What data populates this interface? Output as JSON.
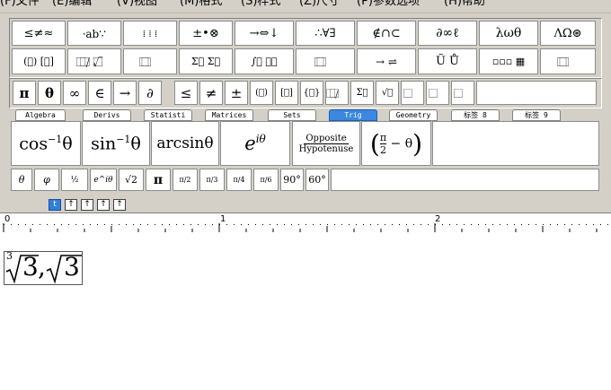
{
  "menubar": {
    "items": [
      {
        "label": "(F)文件"
      },
      {
        "label": "(E)编辑"
      },
      {
        "label": "(V)视图"
      },
      {
        "label": "(M)格式"
      },
      {
        "label": "(S)样式"
      },
      {
        "label": "(Z)尺寸"
      },
      {
        "label": "(P)参数选项"
      },
      {
        "label": "(H)帮助"
      }
    ]
  },
  "symbol_palettes": [
    [
      "≤≠≈",
      "⸱ab∵",
      "⁞ ⁞ ⁞",
      "±•⊗",
      "→⇔↓",
      "∴∀∃",
      "∉∩⊂",
      "∂∞ℓ",
      "λωθ",
      "ΛΩ⊛"
    ],
    [
      "(⃞) [⃞]",
      "⃞/⃞ √⃞",
      "⃞ ⃞",
      "Σ⃞ Σ⃞",
      "∫⃞ ∮⃞",
      "⃞ ⃞",
      "→ ⇌",
      "Ũ Ů",
      "▫▫▫ ▦",
      "⃞ ⃞"
    ]
  ],
  "small_bar": [
    "π",
    "θ",
    "∞",
    "∈",
    "→",
    "∂",
    "≤",
    "≠",
    "±",
    "(⃞)",
    "[⃞]",
    "{⃞}",
    "⃞/⃞",
    "Σ⃞",
    "√⃞",
    "⃞",
    "⃞",
    "⃞"
  ],
  "tabs": [
    "Algebra",
    "Derivs",
    "Statisti",
    "Matrices",
    "Sets",
    "Trig",
    "Geometry",
    "标签 8",
    "标签 9"
  ],
  "templates": [
    {
      "text": "cos⁻¹θ"
    },
    {
      "text": "sin⁻¹θ"
    },
    {
      "text": "arcsinθ"
    },
    {
      "text": "e^iθ"
    },
    {
      "num": "Opposite",
      "den": "Hypotenuse"
    },
    {
      "text": "(π/2 − θ)"
    }
  ],
  "small_templates": [
    "θ",
    "φ",
    "½",
    "e^iθ",
    "√2",
    "π",
    "π/2",
    "π/3",
    "π/4",
    "π/6",
    "90°",
    "60°"
  ],
  "sizebar": {
    "buttons": [
      "t",
      "↑",
      "↑",
      "↑",
      "↑"
    ]
  },
  "ruler": {
    "labels": [
      "0",
      "1",
      "2"
    ]
  },
  "equation": {
    "index": "3",
    "radicand1": "3",
    "separator": ",",
    "radicand2": "3"
  }
}
